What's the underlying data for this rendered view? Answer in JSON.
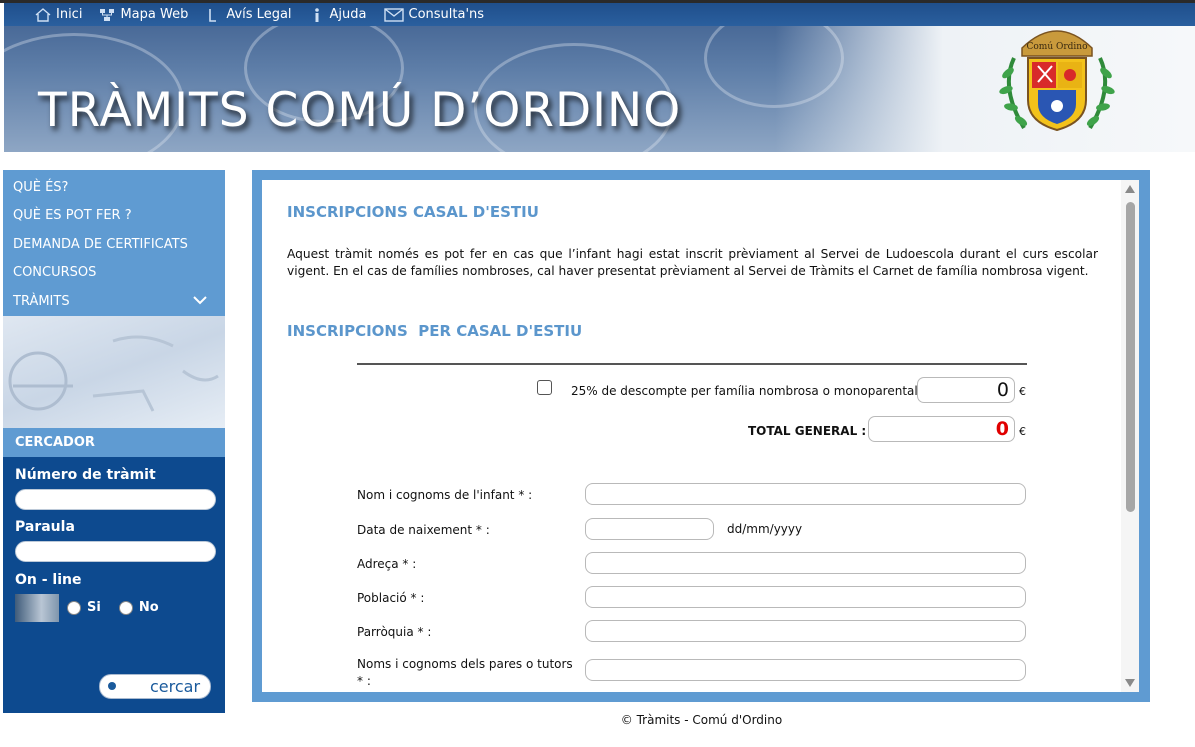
{
  "topnav": {
    "items": [
      {
        "label": "Inici",
        "icon": "home-icon"
      },
      {
        "label": "Mapa Web",
        "icon": "sitemap-icon"
      },
      {
        "label": "Avís Legal",
        "icon": "legal-icon"
      },
      {
        "label": "Ajuda",
        "icon": "info-icon"
      },
      {
        "label": "Consulta'ns",
        "icon": "mail-icon"
      }
    ]
  },
  "banner": {
    "title": "TRÀMITS COMÚ D’ORDINO",
    "crest_text": "Comú Ordino"
  },
  "sidebar": {
    "menu": [
      {
        "label": "QUÈ ÉS?"
      },
      {
        "label": "QUÈ ES POT FER ?"
      },
      {
        "label": "DEMANDA DE CERTIFICATS"
      },
      {
        "label": "CONCURSOS"
      },
      {
        "label": "TRÀMITS",
        "icon": "chevron-down-icon"
      }
    ],
    "search": {
      "heading": "CERCADOR",
      "numero_label": "Número de tràmit",
      "numero_value": "",
      "paraula_label": "Paraula",
      "paraula_value": "",
      "online_label": "On - line",
      "option_si": "Si",
      "option_no": "No",
      "button_label": "cercar"
    }
  },
  "main": {
    "title1": "INSCRIPCIONS CASAL D'ESTIU",
    "intro": "Aquest tràmit només es pot fer en cas que l’infant hagi estat inscrit prèviament al Servei de Ludoescola durant el curs escolar vigent. En el cas de famílies nombroses, cal haver presentat prèviament al Servei de Tràmits el Carnet de família nombrosa vigent.",
    "title2": "INSCRIPCIONS  PER CASAL D'ESTIU",
    "discount_label": "25% de descompte per família nombrosa o monoparental :",
    "discount_value": "0",
    "discount_checked": false,
    "currency": "€",
    "total_label": "TOTAL GENERAL :",
    "total_value": "0",
    "total_color": "#e00000",
    "fields": [
      {
        "label": "Nom i cognoms de l'infant * :",
        "value": ""
      },
      {
        "label": "Data de naixement * :",
        "value": "",
        "hint": "dd/mm/yyyy"
      },
      {
        "label": "Adreça * :",
        "value": ""
      },
      {
        "label": "Població * :",
        "value": ""
      },
      {
        "label": "Parròquia * :",
        "value": ""
      },
      {
        "label": "Noms i cognoms dels pares o tutors * :",
        "value": ""
      }
    ]
  },
  "footer": {
    "text": "© Tràmits - Comú d'Ordino"
  },
  "colors": {
    "nav_bg": "#1f4f8c",
    "sidebar_light": "#5f9bd2",
    "sidebar_dark": "#0d4a8f",
    "section_title": "#5b96cc"
  }
}
